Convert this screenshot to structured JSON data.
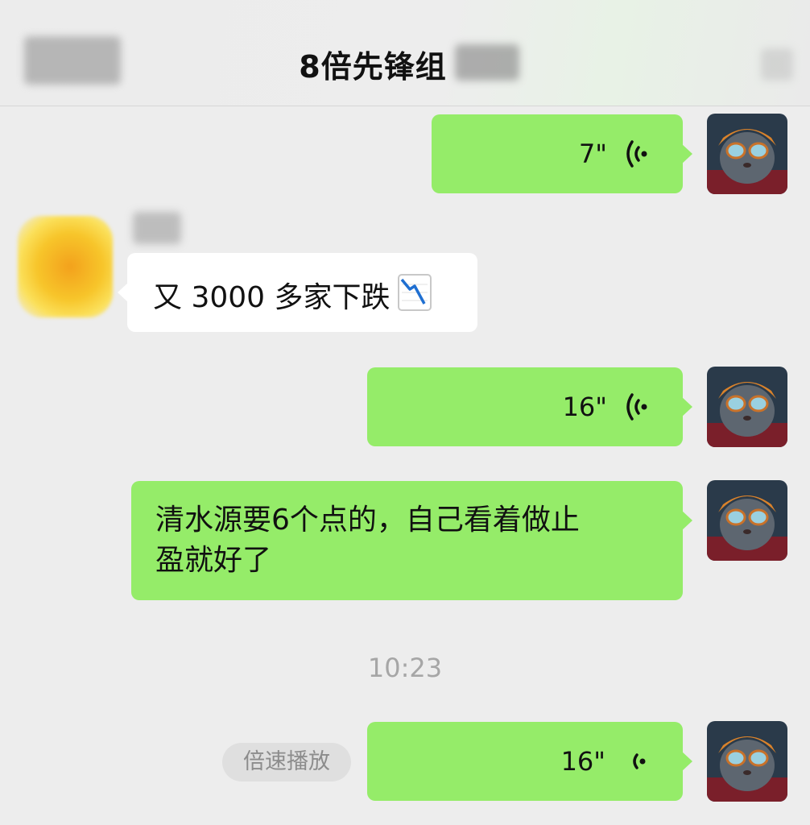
{
  "header": {
    "title": "8倍先锋组"
  },
  "messages": [
    {
      "side": "me",
      "type": "voice",
      "duration": "7\""
    },
    {
      "side": "other",
      "type": "text",
      "text": "又 3000 多家下跌",
      "emoji": "chart-decreasing-icon"
    },
    {
      "side": "me",
      "type": "voice",
      "duration": "16\""
    },
    {
      "side": "me",
      "type": "text",
      "line1": "清水源要6个点的，自己看着做止",
      "line2": "盈就好了"
    },
    {
      "side": "me",
      "type": "voice",
      "duration": "16\""
    }
  ],
  "timestamp": "10:23",
  "speed_button": "倍速播放",
  "colors": {
    "my_bubble": "#95ec69",
    "other_bubble": "#ffffff",
    "background": "#ededed"
  }
}
